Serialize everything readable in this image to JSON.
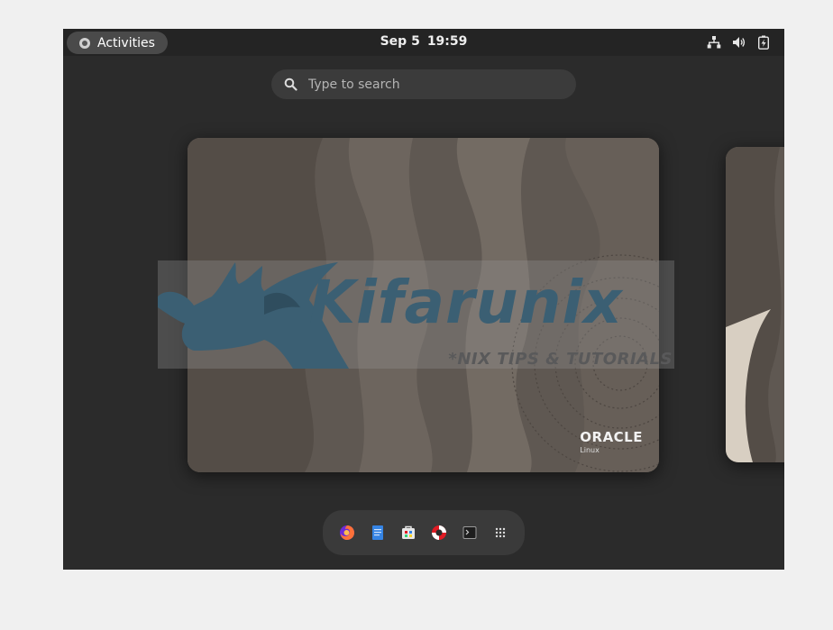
{
  "topbar": {
    "activities_label": "Activities",
    "date": "Sep 5",
    "time": "19:59",
    "tray": [
      "network-icon",
      "volume-icon",
      "battery-icon"
    ]
  },
  "search": {
    "placeholder": "Type to search"
  },
  "workspace": {
    "brand_name": "ORACLE",
    "brand_sub": "Linux"
  },
  "watermark": {
    "title": "Kifarunix",
    "subtitle": "*NIX TIPS & TUTORIALS"
  },
  "dock": {
    "items": [
      "firefox-icon",
      "text-editor-icon",
      "software-icon",
      "help-icon",
      "terminal-icon",
      "app-grid-icon"
    ]
  },
  "colors": {
    "panel": "#242424",
    "overview_bg": "#2b2b2b",
    "watermark_blue": "#3b5f73"
  }
}
